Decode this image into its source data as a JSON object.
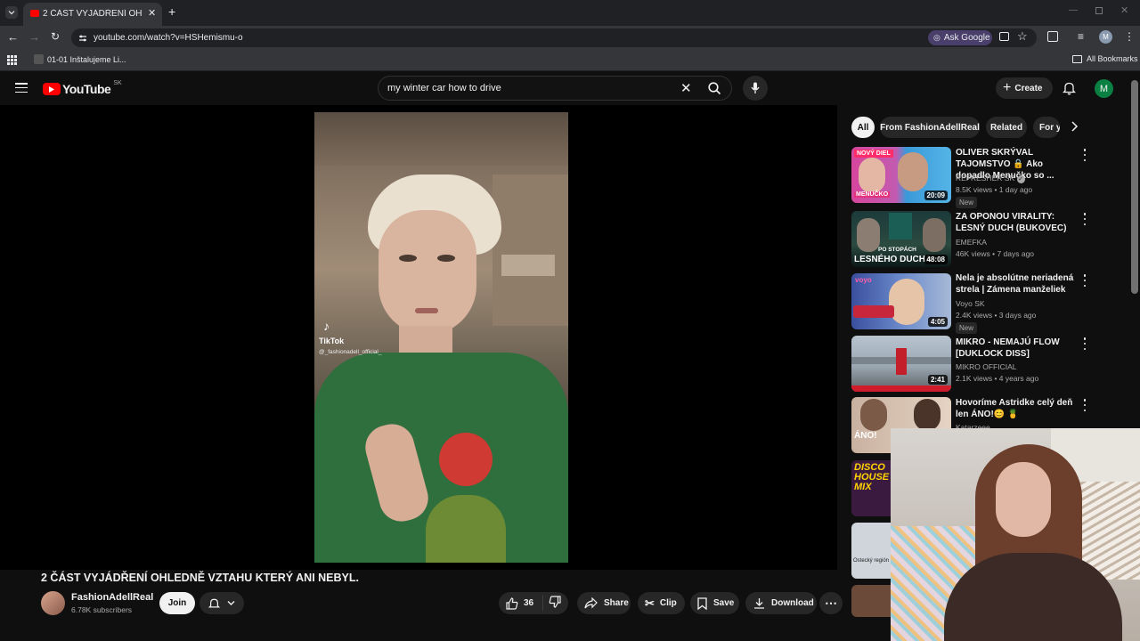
{
  "browser": {
    "tab_title": "2 ČÁST VYJÁDŘENÍ OHLEDNÉ V",
    "url": "youtube.com/watch?v=HSHemismu-o",
    "ask_google": "Ask Google",
    "bookmark_1": "01-01 Inštalujeme Li...",
    "all_bookmarks": "All Bookmarks",
    "profile_initial": "M"
  },
  "youtube": {
    "logo": "YouTube",
    "region": "SK",
    "search_value": "my winter car how to drive",
    "create_label": "Create",
    "avatar_initial": "M"
  },
  "video": {
    "tiktok_label": "TikTok",
    "tiktok_handle": "@_fashionadell_official_",
    "title": "2 ČÁST VYJÁDŘENÍ OHLEDNĚ VZTAHU KTERÝ ANI NEBYL.",
    "channel_name": "FashionAdellReal",
    "subscribers": "6.78K subscribers",
    "join_label": "Join",
    "likes": "36",
    "share_label": "Share",
    "clip_label": "Clip",
    "save_label": "Save",
    "download_label": "Download"
  },
  "filters": [
    "All",
    "From FashionAdellReal",
    "Related",
    "For y"
  ],
  "recommendations": [
    {
      "title": "OLIVER SKRÝVAL TAJOMSTVO 🔒 Ako dopadlo Menučko so ...",
      "channel": "REFRESHER SK",
      "verified": true,
      "meta": "8.5K views • 1 day ago",
      "new": "New",
      "duration": "20:09",
      "thumb_text": "NOVÝ DIEL",
      "thumb_text2": "MENUČKO"
    },
    {
      "title": "ZA OPONOU VIRALITY: LESNÝ DUCH (BUKOVEC)",
      "channel": "EMEFKA",
      "verified": false,
      "meta": "46K views • 7 days ago",
      "new": "",
      "duration": "48:08",
      "thumb_text": "PO STOPÁCH",
      "thumb_text2": "LESNÉHO DUCHA"
    },
    {
      "title": "Nela je absolútne neriadená strela | Zámena manželiek",
      "channel": "Voyo SK",
      "verified": false,
      "meta": "2.4K views • 3 days ago",
      "new": "New",
      "duration": "4:05",
      "thumb_text": "voyo",
      "thumb_text2": ""
    },
    {
      "title": "MIKRO - NEMAJÚ FLOW [DUKLOCK DISS]",
      "channel": "MIKRO OFFICIAL",
      "verified": false,
      "meta": "2.1K views • 4 years ago",
      "new": "",
      "duration": "2:41",
      "thumb_text": "",
      "thumb_text2": ""
    },
    {
      "title": "Hovoríme Astridke celý deň len ÁNO!😊 🍍",
      "channel": "Katarzeee",
      "verified": false,
      "meta": "",
      "new": "",
      "duration": "",
      "thumb_text": "ÁNO!",
      "thumb_text2": ""
    }
  ],
  "extra_thumbs": {
    "disco": "DISCO HOUSE MIX",
    "region": "Ostecký región"
  }
}
